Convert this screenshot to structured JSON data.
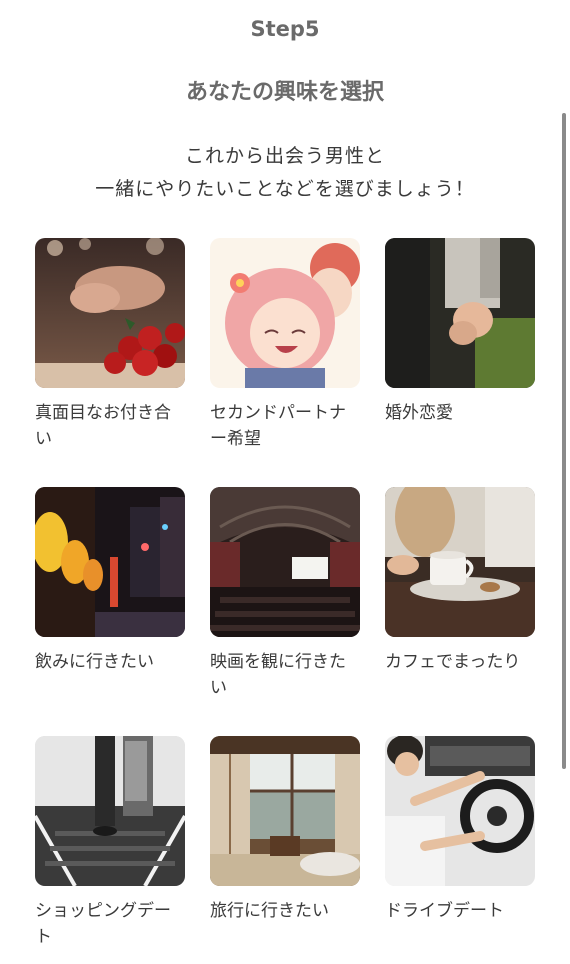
{
  "header": {
    "step": "Step5",
    "title": "あなたの興味を選択",
    "subtitle_line1": "これから出会う男性と",
    "subtitle_line2": "一緒にやりたいことなどを選びましょう！"
  },
  "interests": [
    {
      "label": "真面目なお付き合い",
      "image": "roses-holding-hands-photo"
    },
    {
      "label": "セカンドパートナー希望",
      "image": "anime-couple-illustration"
    },
    {
      "label": "婚外恋愛",
      "image": "holding-hands-photo"
    },
    {
      "label": "飲みに行きたい",
      "image": "night-alley-lanterns-photo"
    },
    {
      "label": "映画を観に行きたい",
      "image": "movie-theater-photo"
    },
    {
      "label": "カフェでまったり",
      "image": "coffee-cup-photo"
    },
    {
      "label": "ショッピングデート",
      "image": "escalator-shopping-photo"
    },
    {
      "label": "旅行に行きたい",
      "image": "japanese-inn-room-photo"
    },
    {
      "label": "ドライブデート",
      "image": "driving-car-photo"
    }
  ]
}
